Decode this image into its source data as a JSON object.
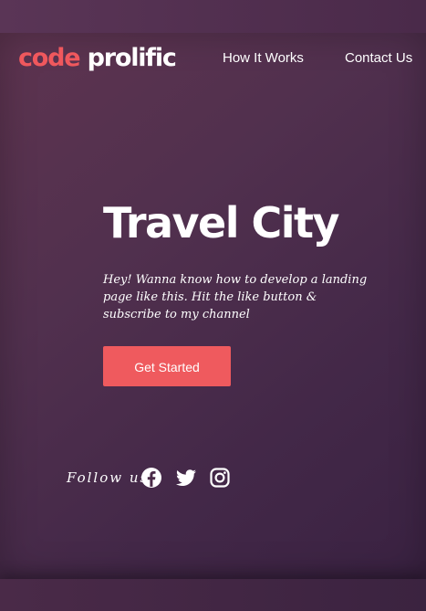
{
  "brand": {
    "logo_part1": "code",
    "logo_part2": "prolific",
    "accent_color": "#ef5a5e"
  },
  "nav": {
    "items": [
      {
        "label": "How It Works"
      },
      {
        "label": "Contact Us"
      }
    ]
  },
  "hero": {
    "title": "Travel City",
    "subtitle": "Hey! Wanna know how to develop a landing page like this. Hit the like button & subscribe to my channel",
    "cta_label": "Get Started"
  },
  "social": {
    "follow_label": "Follow us:",
    "icons": [
      "facebook-icon",
      "twitter-icon",
      "instagram-icon"
    ]
  }
}
